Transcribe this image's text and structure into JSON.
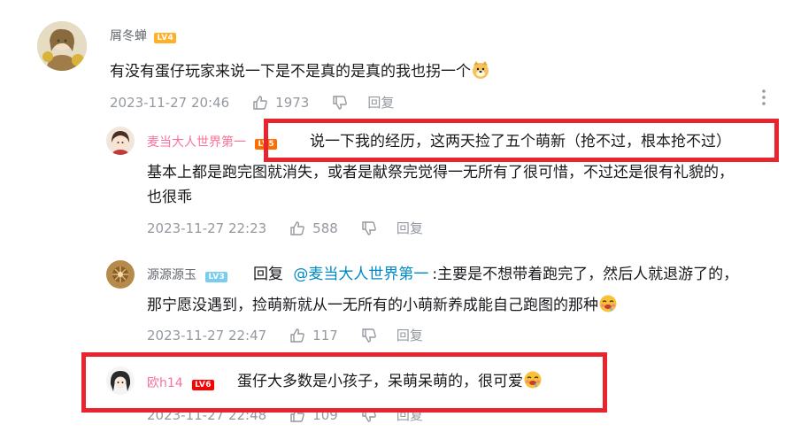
{
  "colors": {
    "accent_pink": "#fb7299",
    "meta_gray": "#9499a0",
    "highlight_red": "#e8242e",
    "link_blue": "#008ac5"
  },
  "main_comment": {
    "username": "屑冬蝉",
    "level": "LV4",
    "text": "有没有蛋仔玩家来说一下是不是真的是真的我也拐一个",
    "emoji": "doge-emoji",
    "time": "2023-11-27 20:46",
    "likes": "1973",
    "reply_label": "回复"
  },
  "replies": [
    {
      "username": "麦当大人世界第一",
      "level": "LV5",
      "text_line1": "说一下我的经历，这两天捡了五个萌新（抢不过，根本抢不过）",
      "text_line2": "基本上都是跑完图就消失，或者是献祭完觉得一无所有了很可惜，不过还是很有礼貌的，",
      "text_line3": "也很乖",
      "time": "2023-11-27 22:23",
      "likes": "588",
      "reply_label": "回复"
    },
    {
      "username": "源源源玉",
      "level": "LV3",
      "reply_prefix": "回复",
      "mention": "@麦当大人世界第一",
      "text_line1": ":主要是不想带着跑完了，然后人就退游了的，",
      "text_line2": "那宁愿没遇到，捡萌新就从一无所有的小萌新养成能自己跑图的那种",
      "emoji": "drool-emoji",
      "time": "2023-11-27 22:47",
      "likes": "117",
      "reply_label": "回复"
    },
    {
      "username": "欧h14",
      "level": "LV6",
      "text": "蛋仔大多数是小孩子，呆萌呆萌的，很可爱",
      "emoji": "drool-emoji",
      "time": "2023-11-27 22:48",
      "likes": "109",
      "reply_label": "回复"
    }
  ]
}
